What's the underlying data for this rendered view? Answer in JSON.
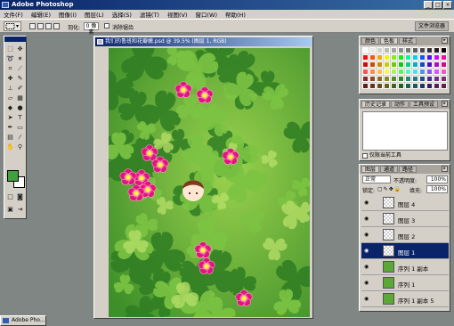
{
  "app": {
    "title": "Adobe Photoshop"
  },
  "menu": [
    "文件(F)",
    "编辑(E)",
    "图像(I)",
    "图层(L)",
    "选择(S)",
    "滤镜(T)",
    "视图(V)",
    "窗口(W)",
    "帮助(H)"
  ],
  "options": {
    "feather_label": "羽化:",
    "feather_value": "0 像素",
    "antialias_label": "消除锯齿",
    "file_browser": "文件浏览器"
  },
  "document": {
    "title": "我们的鲁班和花瓣嫩.psd @ 39.5% (图层 1, RGB)"
  },
  "swatches_panel": {
    "tabs": [
      "颜色",
      "色板",
      "样式"
    ]
  },
  "history_panel": {
    "tabs": [
      "历史记录",
      "动作",
      "工具预设"
    ],
    "tool_label": "仅限当前工具"
  },
  "layers_panel": {
    "tabs": [
      "图层",
      "通道",
      "路径"
    ],
    "blend_mode": "正常",
    "opacity_label": "不透明度:",
    "opacity_value": "100%",
    "lock_label": "锁定:",
    "fill_label": "填充:",
    "fill_value": "100%",
    "layers": [
      "图层 4",
      "图层 3",
      "图层 2",
      "图层 1",
      "序列 1 副本",
      "序列 1",
      "序列 1 副本 5"
    ],
    "selected_layer": "图层 1"
  },
  "taskbar": {
    "label": "Adobe Pho..."
  },
  "colors": {
    "canvas_green": "#5aa936",
    "flower_pink": "#e2157c",
    "selection_blue": "#0a246a",
    "foreground_swatch": "#41a141"
  }
}
